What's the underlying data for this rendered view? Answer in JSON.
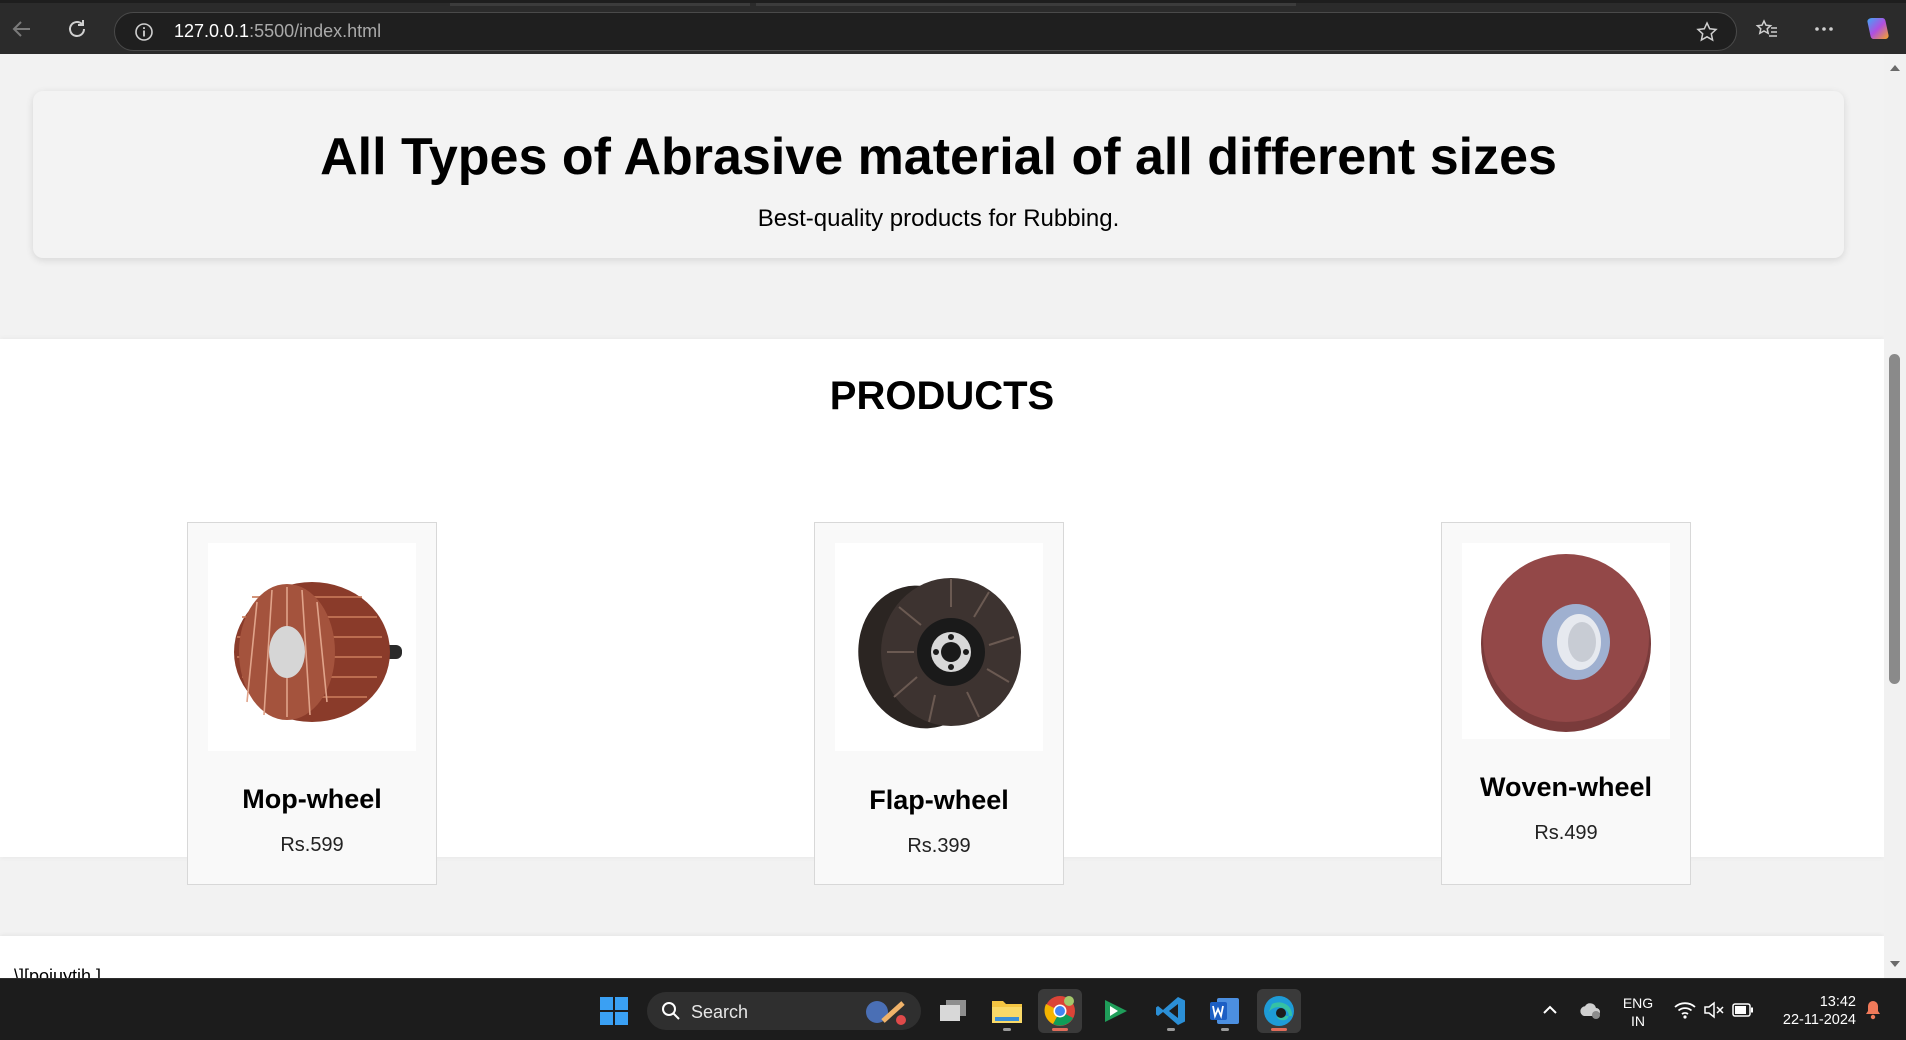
{
  "browser": {
    "url_host": "127.0.0.1",
    "url_path": ":5500/index.html"
  },
  "hero": {
    "title": "All Types of Abrasive material of all different sizes",
    "subtitle": "Best-quality products for Rubbing."
  },
  "products": {
    "heading": "PRODUCTS",
    "items": [
      {
        "name": "Mop-wheel",
        "price": "Rs.599",
        "icon": "mop-wheel-image"
      },
      {
        "name": "Flap-wheel",
        "price": "Rs.399",
        "icon": "flap-wheel-image"
      },
      {
        "name": "Woven-wheel",
        "price": "Rs.499",
        "icon": "woven-wheel-image"
      }
    ]
  },
  "footer": {
    "text": "\\][poiuytjh ]"
  },
  "taskbar": {
    "search_label": "Search",
    "lang_top": "ENG",
    "lang_bottom": "IN",
    "time": "13:42",
    "date": "22-11-2024"
  },
  "colors": {
    "page_bg": "#f2f2f2",
    "card_bg": "#f9f9f9",
    "taskbar_bg": "#1c1c1c"
  }
}
